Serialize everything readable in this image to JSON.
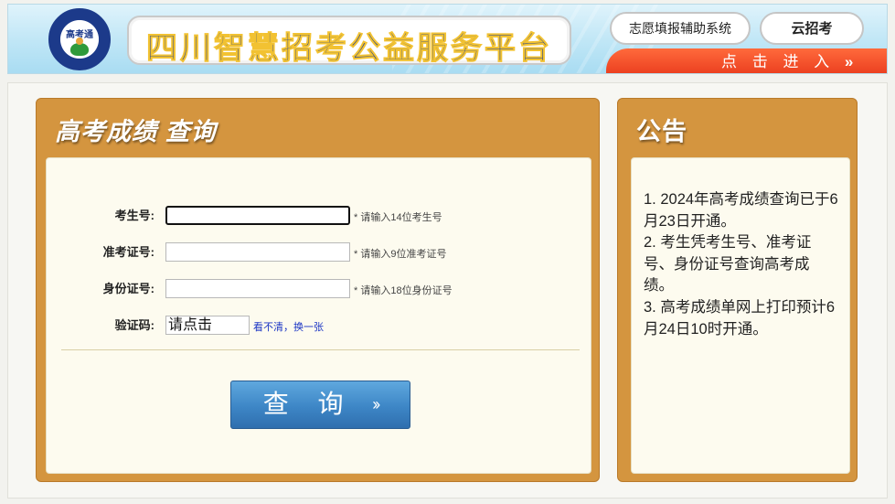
{
  "header": {
    "logo_text": "高考通",
    "site_title": "四川智慧招考公益服务平台",
    "volunteer_system_label": "志愿填报辅助系统",
    "cloud_label": "云招考",
    "enter_label": "点 击 进 入",
    "enter_chevron": "»"
  },
  "score_panel": {
    "title": "高考成绩  查询",
    "fields": [
      {
        "label": "考生号:",
        "value": "",
        "hint": "* 请输入14位考生号"
      },
      {
        "label": "准考证号:",
        "value": "",
        "hint": "* 请输入9位准考证号"
      },
      {
        "label": "身份证号:",
        "value": "",
        "hint": "* 请输入18位身份证号"
      }
    ],
    "captcha_label": "验证码:",
    "captcha_placeholder": "请点击",
    "captcha_refresh_label": "看不清，换一张",
    "submit_label": "查 询",
    "submit_arrows": "››"
  },
  "notice_panel": {
    "title": "公告",
    "items": [
      "1. 2024年高考成绩查询已于6月23日开通。",
      "2. 考生凭考生号、准考证号、身份证号查询高考成绩。",
      "3. 高考成绩单网上打印预计6月24日10时开通。"
    ]
  },
  "colors": {
    "panel_orange": "#d4953f",
    "inner_cream": "#fdfbef",
    "submit_blue": "#3d86c6",
    "enter_red": "#ea3c1e",
    "title_blue": "#1d3f95"
  }
}
